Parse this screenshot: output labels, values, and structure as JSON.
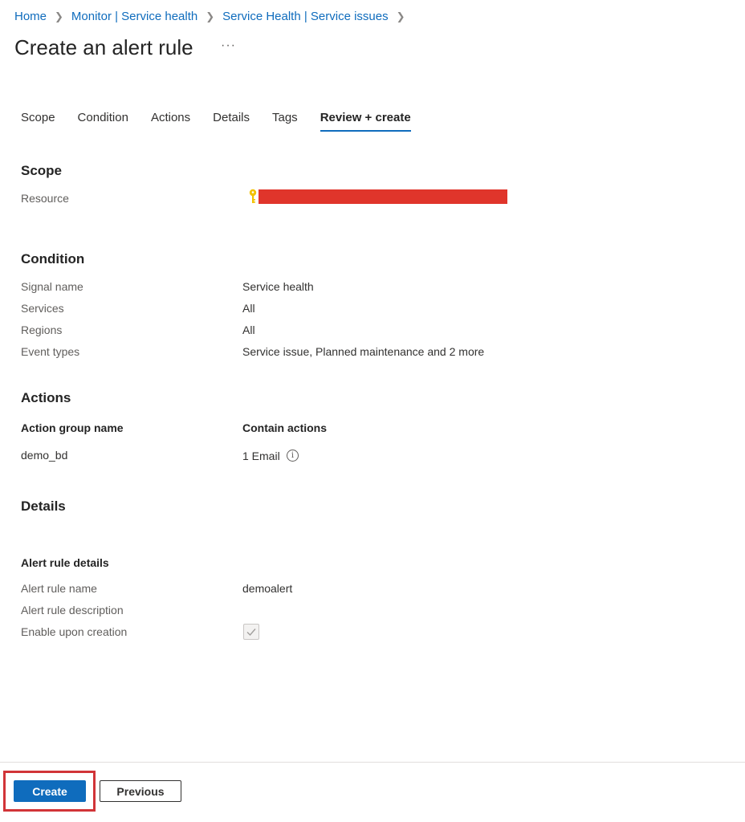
{
  "breadcrumb": {
    "items": [
      "Home",
      "Monitor | Service health",
      "Service Health | Service issues"
    ],
    "separator": ">"
  },
  "page": {
    "title": "Create an alert rule",
    "more_label": "···"
  },
  "tabs": [
    {
      "label": "Scope",
      "active": false
    },
    {
      "label": "Condition",
      "active": false
    },
    {
      "label": "Actions",
      "active": false
    },
    {
      "label": "Details",
      "active": false
    },
    {
      "label": "Tags",
      "active": false
    },
    {
      "label": "Review + create",
      "active": true
    }
  ],
  "scope": {
    "title": "Scope",
    "resource_label": "Resource",
    "resource_icon": "key-icon",
    "resource_redaction_color": "#e0352b"
  },
  "condition": {
    "title": "Condition",
    "rows": [
      {
        "label": "Signal name",
        "value": "Service health"
      },
      {
        "label": "Services",
        "value": "All"
      },
      {
        "label": "Regions",
        "value": "All"
      },
      {
        "label": "Event types",
        "value": "Service issue, Planned maintenance and 2 more"
      }
    ]
  },
  "actions": {
    "title": "Actions",
    "col_group": "Action group name",
    "col_contain": "Contain actions",
    "group_name": "demo_bd",
    "contain": "1 Email",
    "info_icon": "info-icon"
  },
  "details": {
    "title": "Details",
    "subtitle": "Alert rule details",
    "rows": [
      {
        "label": "Alert rule name",
        "value": "demoalert"
      },
      {
        "label": "Alert rule description",
        "value": ""
      },
      {
        "label": "Enable upon creation",
        "value": ""
      }
    ],
    "enable_checked": true
  },
  "footer": {
    "create_label": "Create",
    "previous_label": "Previous",
    "accent_color": "#0f6cbd",
    "highlight_color": "#d13438"
  }
}
